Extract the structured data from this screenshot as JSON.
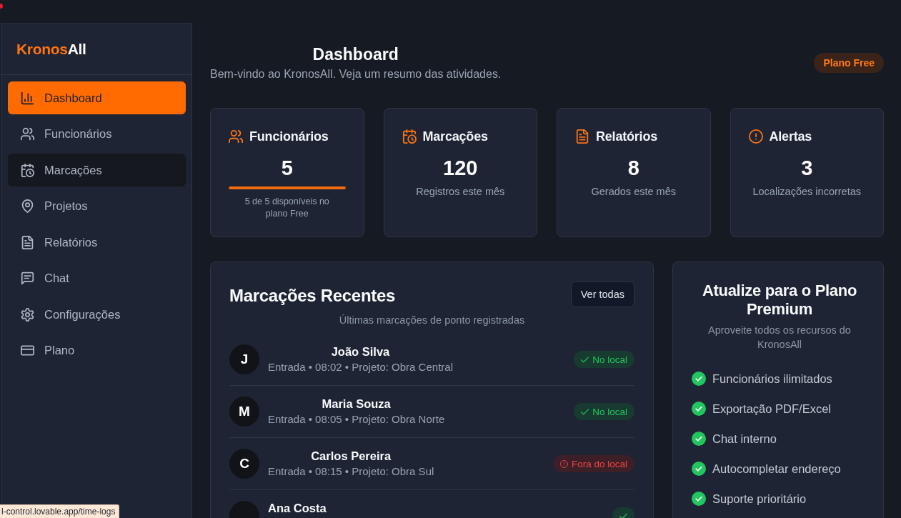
{
  "sidebar": {
    "logo": {
      "accent": "Kronos",
      "rest": "All"
    },
    "items": [
      {
        "label": "Dashboard",
        "selected": true,
        "hovered": false
      },
      {
        "label": "Funcionários",
        "selected": false,
        "hovered": false
      },
      {
        "label": "Marcações",
        "selected": false,
        "hovered": true
      },
      {
        "label": "Projetos",
        "selected": false,
        "hovered": false
      },
      {
        "label": "Relatórios",
        "selected": false,
        "hovered": false
      },
      {
        "label": "Chat",
        "selected": false,
        "hovered": false
      },
      {
        "label": "Configurações",
        "selected": false,
        "hovered": false
      },
      {
        "label": "Plano",
        "selected": false,
        "hovered": false
      }
    ]
  },
  "header": {
    "title": "Dashboard",
    "subtitle": "Bem-vindo ao KronosAll. Veja um resumo das atividades.",
    "plan_badge": "Plano Free"
  },
  "stats": [
    {
      "title": "Funcionários",
      "value": "5",
      "progress": {
        "level": 1
      },
      "note": "5 de 5 disponíveis no plano Free"
    },
    {
      "title": "Marcações",
      "value": "120",
      "note": "Registros este mês"
    },
    {
      "title": "Relatórios",
      "value": "8",
      "note": "Gerados este mês"
    },
    {
      "title": "Alertas",
      "value": "3",
      "note": "Localizações incorretas"
    }
  ],
  "recent": {
    "title": "Marcações Recentes",
    "view_all": "Ver todas",
    "subtitle": "Últimas marcações de ponto registradas",
    "rows": [
      {
        "initial": "J",
        "name": "João Silva",
        "detail": "Entrada • 08:02 • Projeto: Obra Central",
        "status": {
          "kind": "ok",
          "label": "No local"
        }
      },
      {
        "initial": "M",
        "name": "Maria Souza",
        "detail": "Entrada • 08:05 • Projeto: Obra Norte",
        "status": {
          "kind": "ok",
          "label": "No local"
        }
      },
      {
        "initial": "C",
        "name": "Carlos Pereira",
        "detail": "Entrada • 08:15 • Projeto: Obra Sul",
        "status": {
          "kind": "out",
          "label": "Fora do local"
        }
      },
      {
        "name": "Ana Costa",
        "status": {
          "kind": "ok"
        }
      }
    ]
  },
  "premium": {
    "title": "Atualize para o Plano Premium",
    "subtitle": "Aproveite todos os recursos do KronosAll",
    "features": [
      "Funcionários ilimitados",
      "Exportação PDF/Excel",
      "Chat interno",
      "Autocompletar endereço",
      "Suporte prioritário"
    ]
  },
  "status_url": "l-control.lovable.app/time-logs"
}
